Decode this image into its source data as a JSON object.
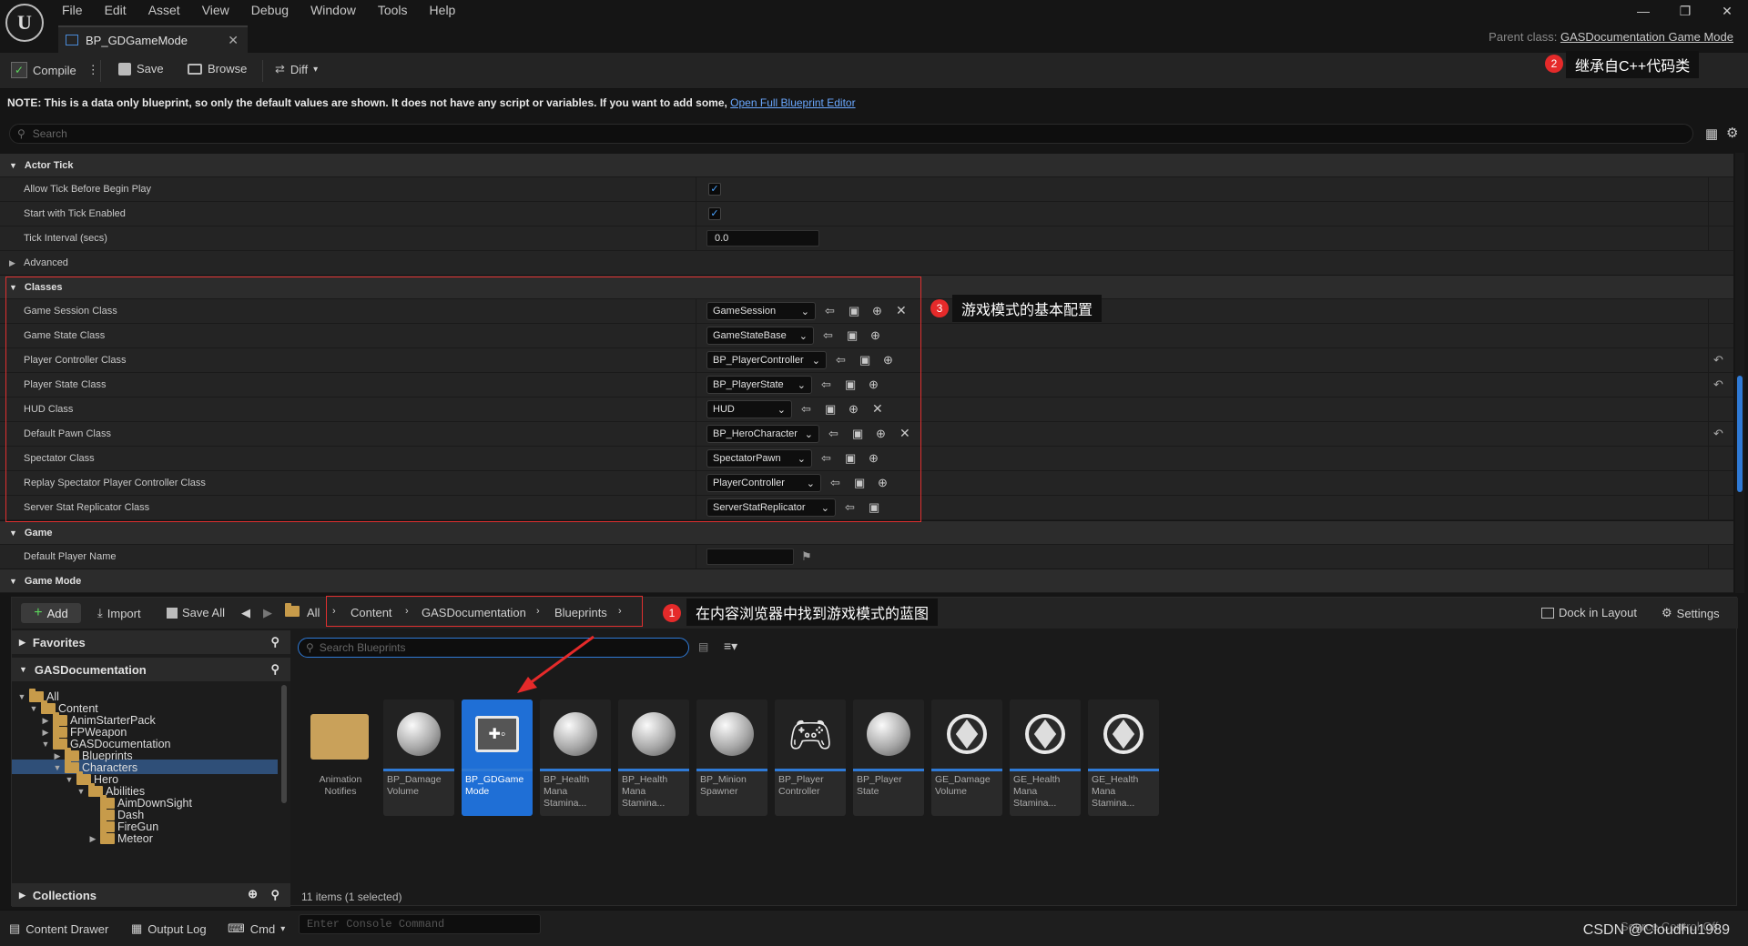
{
  "titlebar": {
    "menu": [
      "File",
      "Edit",
      "Asset",
      "View",
      "Debug",
      "Window",
      "Tools",
      "Help"
    ],
    "tab_title": "BP_GDGameMode",
    "parent_class_label": "Parent class:",
    "parent_class_value": "GASDocumentation Game Mode"
  },
  "toolbar": {
    "compile": "Compile",
    "save": "Save",
    "browse": "Browse",
    "diff": "Diff"
  },
  "annotations": {
    "a1": {
      "num": "1",
      "text": "在内容浏览器中找到游戏模式的蓝图"
    },
    "a2": {
      "num": "2",
      "text": "继承自C++代码类"
    },
    "a3": {
      "num": "3",
      "text": "游戏模式的基本配置"
    }
  },
  "note": {
    "text": "NOTE: This is a data only blueprint, so only the default values are shown.  It does not have any script or variables.  If you want to add some,",
    "link": "Open Full Blueprint Editor"
  },
  "details": {
    "search_placeholder": "Search",
    "actor_tick": {
      "title": "Actor Tick",
      "allow_tick": "Allow Tick Before Begin Play",
      "start_tick": "Start with Tick Enabled",
      "interval_label": "Tick Interval (secs)",
      "interval_value": "0.0",
      "advanced": "Advanced"
    },
    "classes": {
      "title": "Classes",
      "rows": [
        {
          "label": "Game Session Class",
          "value": "GameSession"
        },
        {
          "label": "Game State Class",
          "value": "GameStateBase"
        },
        {
          "label": "Player Controller Class",
          "value": "BP_PlayerController"
        },
        {
          "label": "Player State Class",
          "value": "BP_PlayerState"
        },
        {
          "label": "HUD Class",
          "value": "HUD"
        },
        {
          "label": "Default Pawn Class",
          "value": "BP_HeroCharacter"
        },
        {
          "label": "Spectator Class",
          "value": "SpectatorPawn"
        },
        {
          "label": "Replay Spectator Player Controller Class",
          "value": "PlayerController"
        },
        {
          "label": "Server Stat Replicator Class",
          "value": "ServerStatReplicator"
        }
      ]
    },
    "game": {
      "title": "Game",
      "default_player_name": "Default Player Name"
    },
    "game_mode": {
      "title": "Game Mode"
    }
  },
  "content_browser": {
    "add": "Add",
    "import": "Import",
    "save_all": "Save All",
    "path": [
      "All",
      "Content",
      "GASDocumentation",
      "Blueprints"
    ],
    "dock": "Dock in Layout",
    "settings": "Settings",
    "favorites": "Favorites",
    "project": "GASDocumentation",
    "collections": "Collections",
    "tree": [
      "All",
      "Content",
      "AnimStarterPack",
      "FPWeapon",
      "GASDocumentation",
      "Blueprints",
      "Characters",
      "Hero",
      "Abilities",
      "AimDownSight",
      "Dash",
      "FireGun",
      "Meteor"
    ],
    "search_placeholder": "Search Blueprints",
    "assets": [
      {
        "name": "Animation Notifies"
      },
      {
        "name": "BP_Damage Volume"
      },
      {
        "name": "BP_GDGame Mode"
      },
      {
        "name": "BP_Health Mana Stamina..."
      },
      {
        "name": "BP_Health Mana Stamina..."
      },
      {
        "name": "BP_Minion Spawner"
      },
      {
        "name": "BP_Player Controller"
      },
      {
        "name": "BP_Player State"
      },
      {
        "name": "GE_Damage Volume"
      },
      {
        "name": "GE_Health Mana Stamina..."
      },
      {
        "name": "GE_Health Mana Stamina..."
      }
    ],
    "item_count": "11 items (1 selected)"
  },
  "statusbar": {
    "content_drawer": "Content Drawer",
    "output_log": "Output Log",
    "cmd": "Cmd",
    "console_placeholder": "Enter Console Command",
    "source_control": "Source Control Off",
    "watermark": "CSDN @Cloudhu1989"
  }
}
